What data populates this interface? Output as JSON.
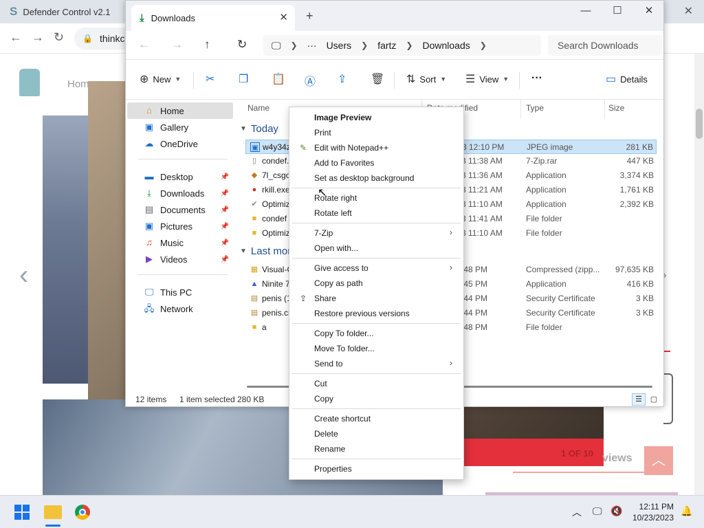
{
  "background_window": {
    "title": "Defender Control v2.1",
    "logo": "S"
  },
  "browser": {
    "address": "thinkc",
    "nav_home": "Hom",
    "slide_counter": "1 OF 10",
    "reviews_heading": "views"
  },
  "explorer": {
    "tab_title": "Downloads",
    "breadcrumb": [
      "Users",
      "fartz",
      "Downloads"
    ],
    "search_placeholder": "Search Downloads",
    "commands": {
      "new": "New",
      "sort": "Sort",
      "view": "View",
      "more": "···",
      "details": "Details"
    },
    "nav": {
      "home": "Home",
      "gallery": "Gallery",
      "onedrive": "OneDrive",
      "desktop": "Desktop",
      "downloads": "Downloads",
      "documents": "Documents",
      "pictures": "Pictures",
      "music": "Music",
      "videos": "Videos",
      "thispc": "This PC",
      "network": "Network"
    },
    "columns": {
      "name": "Name",
      "date": "Date modified",
      "type": "Type",
      "size": "Size"
    },
    "groups": {
      "today": "Today",
      "last": "Last mon"
    },
    "files": [
      {
        "name": "w4y34zl",
        "date": "3 12:10 PM",
        "type": "JPEG image",
        "size": "281 KB"
      },
      {
        "name": "condef.",
        "date": "3 11:38 AM",
        "type": "7-Zip.rar",
        "size": "447 KB"
      },
      {
        "name": "7l_csgo",
        "date": "3 11:36 AM",
        "type": "Application",
        "size": "3,374 KB"
      },
      {
        "name": "rkill.exe",
        "date": "3 11:21 AM",
        "type": "Application",
        "size": "1,761 KB"
      },
      {
        "name": "Optimiz",
        "date": "3 11:10 AM",
        "type": "Application",
        "size": "2,392 KB"
      },
      {
        "name": "condef",
        "date": "3 11:41 AM",
        "type": "File folder",
        "size": ""
      },
      {
        "name": "Optimiz",
        "date": "3 11:10 AM",
        "type": "File folder",
        "size": ""
      },
      {
        "name": "Visual-C",
        "date": ":48 PM",
        "type": "Compressed (zipp...",
        "size": "97,635 KB"
      },
      {
        "name": "Ninite 7",
        "date": ":45 PM",
        "type": "Application",
        "size": "416 KB"
      },
      {
        "name": "penis (1",
        "date": ":44 PM",
        "type": "Security Certificate",
        "size": "3 KB"
      },
      {
        "name": "penis.cr",
        "date": ":44 PM",
        "type": "Security Certificate",
        "size": "3 KB"
      },
      {
        "name": "a",
        "date": ":48 PM",
        "type": "File folder",
        "size": ""
      }
    ],
    "status": {
      "items": "12 items",
      "selected": "1 item selected",
      "size": "280 KB"
    }
  },
  "context_menu": {
    "image_preview": "Image Preview",
    "print": "Print",
    "edit_notepad": "Edit with Notepad++",
    "add_favorites": "Add to Favorites",
    "set_desktop_bg": "Set as desktop background",
    "rotate_right": "Rotate right",
    "rotate_left": "Rotate left",
    "seven_zip": "7-Zip",
    "open_with": "Open with...",
    "give_access": "Give access to",
    "copy_path": "Copy as path",
    "share": "Share",
    "restore_versions": "Restore previous versions",
    "copy_to": "Copy To folder...",
    "move_to": "Move To folder...",
    "send_to": "Send to",
    "cut": "Cut",
    "copy": "Copy",
    "create_shortcut": "Create shortcut",
    "delete": "Delete",
    "rename": "Rename",
    "properties": "Properties"
  },
  "taskbar": {
    "time": "12:11 PM",
    "date": "10/23/2023"
  },
  "colors": {
    "accent": "#1a73e8",
    "selection": "#cce4f7",
    "taskbar": "#e9ecf2"
  }
}
